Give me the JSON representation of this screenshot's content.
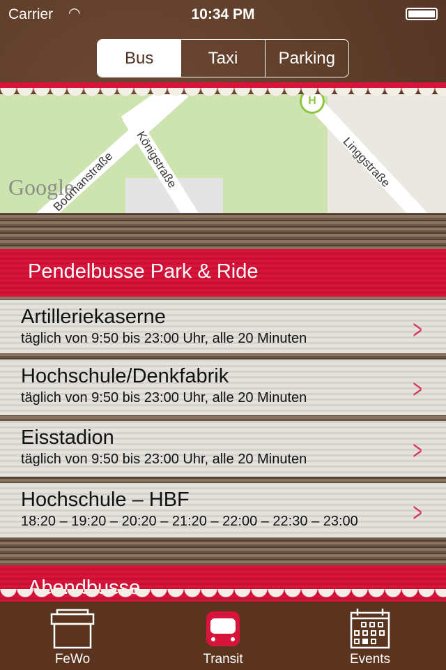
{
  "status": {
    "carrier": "Carrier",
    "time": "10:34 PM",
    "battery_percent": 100
  },
  "segments": {
    "items": [
      "Bus",
      "Taxi",
      "Parking"
    ],
    "selected": "Bus"
  },
  "map": {
    "streets": [
      "Bodmanstraße",
      "Königstraße",
      "Linggstraße"
    ],
    "attribution": "Google"
  },
  "section": {
    "title": "Pendelbusse Park & Ride"
  },
  "routes": [
    {
      "title": "Artilleriekaserne",
      "subtitle": "täglich von 9:50 bis 23:00 Uhr, alle 20 Minuten"
    },
    {
      "title": "Hochschule/Denkfabrik",
      "subtitle": "täglich von 9:50 bis 23:00 Uhr, alle 20 Minuten"
    },
    {
      "title": "Eisstadion",
      "subtitle": "täglich von 9:50 bis 23:00 Uhr, alle 20 Minuten"
    },
    {
      "title": "Hochschule – HBF",
      "subtitle": "18:20 – 19:20 – 20:20 – 21:20 – 22:00 – 22:30 – 23:00"
    }
  ],
  "section2": {
    "title": "Abendbusse"
  },
  "tabs": [
    {
      "label": "FeWo",
      "icon": "house-icon"
    },
    {
      "label": "Transit",
      "icon": "bus-icon",
      "active": true
    },
    {
      "label": "Events",
      "icon": "calendar-icon"
    }
  ],
  "colors": {
    "accent": "#d7153a",
    "wood": "#5b341f"
  }
}
